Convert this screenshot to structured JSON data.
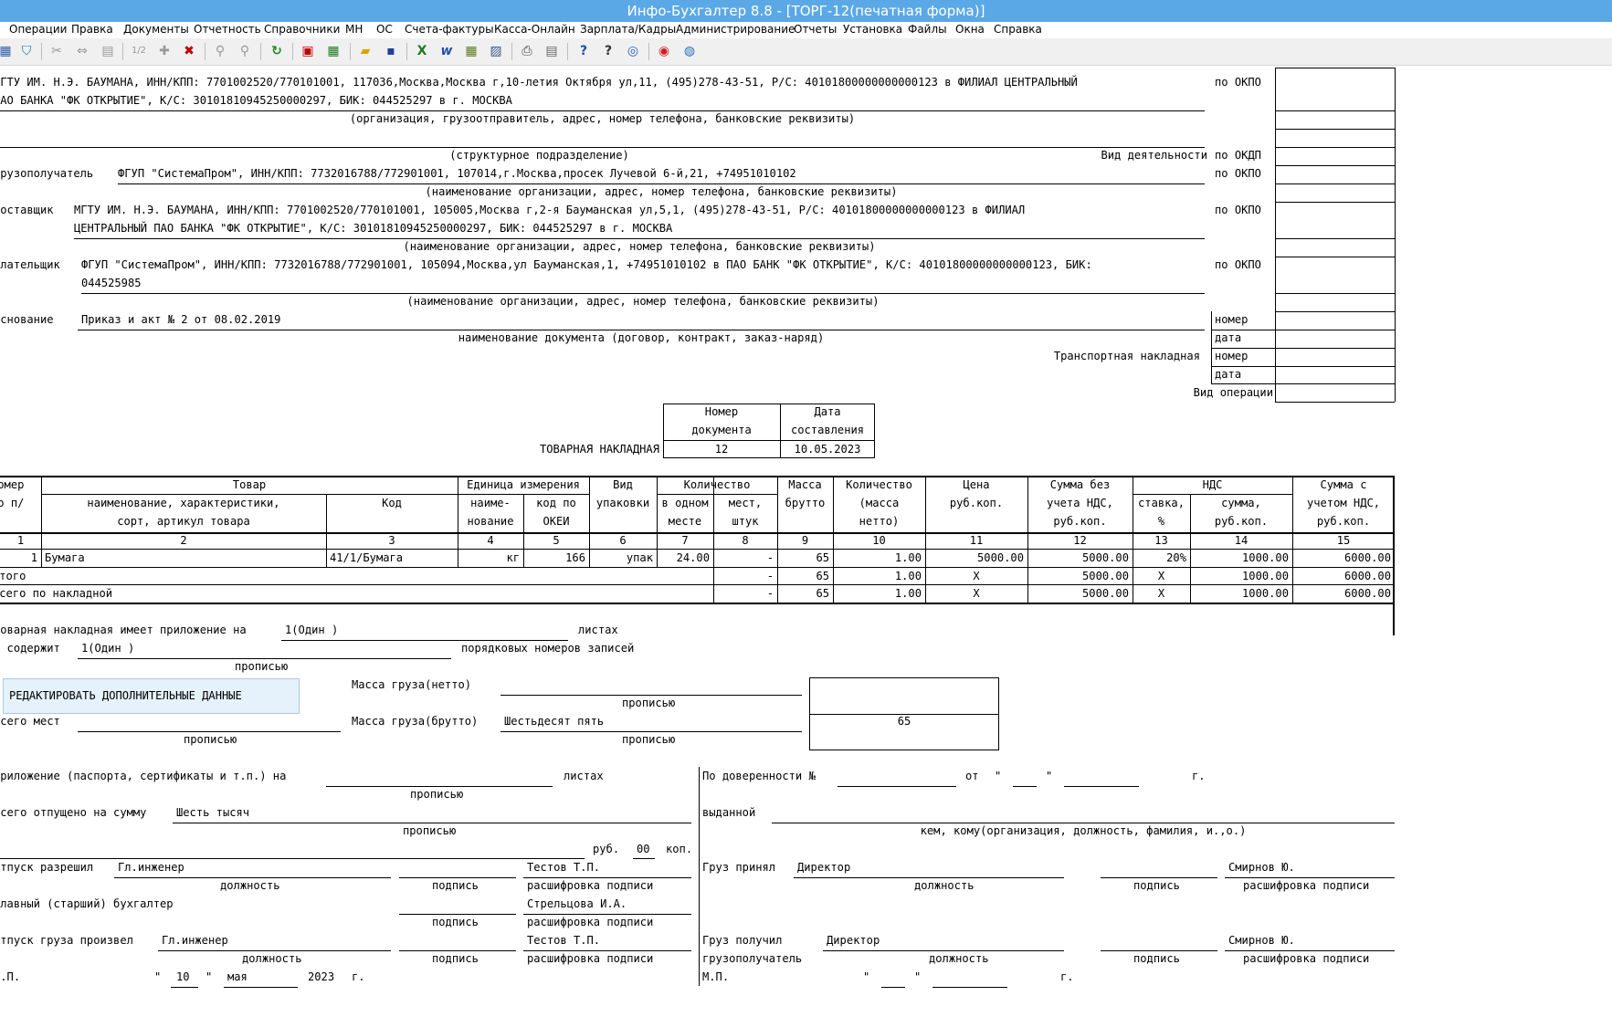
{
  "window": {
    "title": "Инфо-Бухгалтер 8.8 - [ТОРГ-12(печатная форма)]"
  },
  "menu": [
    "Операции",
    "Правка",
    "Документы",
    "Отчетность",
    "Справочники",
    "МН",
    "ОС",
    "Счета-фактуры",
    "Касса-Онлайн",
    "Зарплата/Кадры",
    "Администрирование",
    "Отчеты",
    "Установка",
    "Файлы",
    "Окна",
    "Справка"
  ],
  "toolbar_icons": [
    "table-icon",
    "filter-icon",
    "cut-icon",
    "move-icon",
    "paste-icon",
    "numbering-icon",
    "add-icon",
    "delete-icon",
    "link-icon",
    "unlink-icon",
    "refresh-icon",
    "pdf-icon",
    "calculator-icon",
    "open-folder-icon",
    "save-icon",
    "excel-icon",
    "word-icon",
    "calc-sheet-icon",
    "image-icon",
    "print-icon",
    "preview-icon",
    "help-icon",
    "context-help-icon",
    "compass-icon",
    "lifebuoy-icon",
    "globe-icon"
  ],
  "form": {
    "org_line1": "МГТУ ИМ. Н.Э. БАУМАНА, ИНН/КПП: 7701002520/770101001, 117036,Москва,Москва г,10-летия Октября ул,11, (495)278-43-51, Р/С: 40101800000000000123 в ФИЛИАЛ ЦЕНТРАЛЬНЫЙ",
    "org_line2": "ПАО БАНКА \"ФК ОТКРЫТИЕ\", К/С: 30101810945250000297, БИК: 044525297 в г. МОСКВА",
    "org_caption": "(организация, грузоотправитель, адрес, номер телефона, банковские реквизиты)",
    "dept_caption": "(структурное подразделение)",
    "activity_label": "Вид деятельности",
    "okpo": "по ОКПО",
    "okdp": "по ОКДП",
    "consignee_label": "Грузополучатель",
    "consignee": "ФГУП \"СистемаПром\", ИНН/КПП: 7732016788/772901001, 107014,г.Москва,просек Лучевой 6-й,21, +74951010102",
    "name_caption": "(наименование организации, адрес, номер телефона, банковские реквизиты)",
    "supplier_label": "Поставщик",
    "supplier_line1": "МГТУ ИМ. Н.Э. БАУМАНА, ИНН/КПП: 7701002520/770101001, 105005,Москва г,2-я Бауманская ул,5,1, (495)278-43-51, Р/С: 40101800000000000123 в ФИЛИАЛ",
    "supplier_line2": "ЦЕНТРАЛЬНЫЙ ПАО БАНКА \"ФК ОТКРЫТИЕ\", К/С: 30101810945250000297, БИК: 044525297 в г. МОСКВА",
    "payer_label": "Плательщик",
    "payer_line1": "ФГУП \"СистемаПром\", ИНН/КПП: 7732016788/772901001, 105094,Москва,ул Бауманская,1, +74951010102 в ПАО БАНК \"ФК ОТКРЫТИЕ\", К/С: 40101800000000000123, БИК:",
    "payer_line2": "044525985",
    "basis_label": "Основание",
    "basis": "Приказ и акт № 2 от 08.02.2019",
    "basis_caption": "наименование документа (договор, контракт, заказ-наряд)",
    "nomer": "номер",
    "data": "дата",
    "transport": "Транспортная накладная",
    "operation": "Вид операции",
    "docnum_header": [
      "Номер",
      "документа"
    ],
    "docdate_header": [
      "Дата",
      "составления"
    ],
    "doc_title": "ТОВАРНАЯ НАКЛАДНАЯ",
    "doc_number": "12",
    "doc_date": "10.05.2023"
  },
  "table": {
    "h_num": [
      "Номер",
      "по п/п"
    ],
    "h_goods": "Товар",
    "h_goods_name": [
      "наименование, характеристики,",
      "сорт, артикул товара"
    ],
    "h_code": "Код",
    "h_unit": "Единица измерения",
    "h_unit_name": [
      "наиме-",
      "нование"
    ],
    "h_unit_okei": [
      "код по",
      "ОКЕИ"
    ],
    "h_pack": [
      "Вид",
      "упаковки"
    ],
    "h_qty": "Количество",
    "h_qty_one": [
      "в одном",
      "месте"
    ],
    "h_qty_places": [
      "мест,",
      "штук"
    ],
    "h_gross": [
      "Масса",
      "брутто"
    ],
    "h_net": [
      "Количество",
      "(масса",
      "нетто)"
    ],
    "h_price": [
      "Цена",
      "руб.коп."
    ],
    "h_sum_novat": [
      "Сумма без",
      "учета НДС,",
      "руб.коп."
    ],
    "h_vat": "НДС",
    "h_vat_rate": [
      "ставка,",
      "%"
    ],
    "h_vat_sum": [
      "сумма,",
      "руб.коп."
    ],
    "h_sum_vat": [
      "Сумма с",
      "учетом НДС,",
      "руб.коп."
    ],
    "colnums": [
      "1",
      "2",
      "3",
      "4",
      "5",
      "6",
      "7",
      "8",
      "9",
      "10",
      "11",
      "12",
      "13",
      "14",
      "15"
    ],
    "row": [
      "1",
      "Бумага",
      "41/1/Бумага",
      "кг",
      "166",
      "упак",
      "24.00",
      "-",
      "65",
      "1.00",
      "5000.00",
      "5000.00",
      "20%",
      "1000.00",
      "6000.00"
    ],
    "itogo_label": "Итого",
    "itogo": [
      "-",
      "65",
      "1.00",
      "X",
      "5000.00",
      "X",
      "1000.00",
      "6000.00"
    ],
    "vsego_label": "Всего по накладной",
    "vsego": [
      "-",
      "65",
      "1.00",
      "X",
      "5000.00",
      "X",
      "1000.00",
      "6000.00"
    ]
  },
  "footer": {
    "appendix_label": "Товарная накладная имеет приложение на",
    "appendix_value": "1(Один )",
    "sheets": "листах",
    "contains_label": "и содержит",
    "contains_value": "1(Один )",
    "records": "порядковых номеров записей",
    "propisyu": "прописью",
    "edit_button": "РЕДАКТИРОВАТЬ ДОПОЛНИТЕЛЬНЫЕ ДАННЫЕ",
    "net_mass_label": "Масса груза(нетто)",
    "gross_mass_label": "Масса груза(брутто)",
    "gross_mass_value": "Шестьдесят пять",
    "gross_box_value": "65",
    "places_label": "Всего мест",
    "attach_label": "Приложение (паспорта, сертификаты и т.п.) на",
    "released_sum_label": "Всего отпущено на сумму",
    "released_sum_value": "Шесть тысяч",
    "rub": "руб.",
    "kop_value": "00",
    "kop": "коп.",
    "allowed_label": "Отпуск разрешил",
    "allowed_position": "Гл.инженер",
    "allowed_name": "Тестов Т.П.",
    "position": "должность",
    "signature": "подпись",
    "decode": "расшифровка подписи",
    "chief_label": "Главный (старший) бухгалтер",
    "chief_name": "Стрельцова И.А.",
    "shipped_label": "Отпуск груза произвел",
    "shipped_position": "Гл.инженер",
    "shipped_name": "Тестов Т.П.",
    "mp": "М.П.",
    "date_day": "10",
    "date_month": "мая",
    "date_year": "2023",
    "year_g": "г.",
    "proxy_label": "По доверенности №",
    "from": "от",
    "issued_label": "выданной",
    "issued_caption": "кем, кому(организация, должность, фамилия, и.,о.)",
    "accepted_label": "Груз принял",
    "accepted_position": "Директор",
    "accepted_name": "Смирнов Ю.",
    "received_label": "Груз получил",
    "received_label2": "грузополучатель",
    "received_position": "Директор",
    "received_name": "Смирнов Ю."
  }
}
